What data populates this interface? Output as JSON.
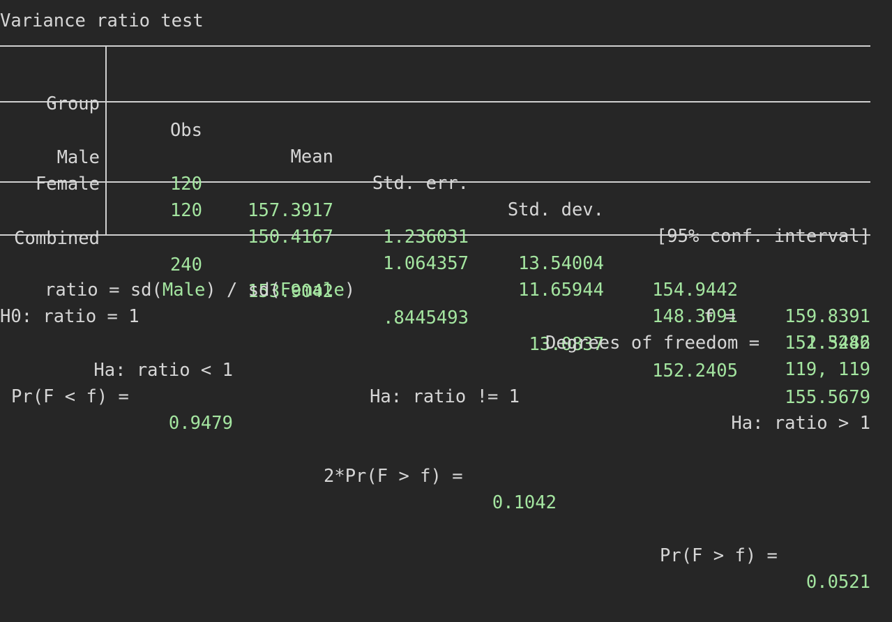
{
  "terminal": {
    "background_color": "#262626",
    "text_color": "#d6d6d6",
    "value_color": "#a4e5a0",
    "rule_color": "#d0d0d0"
  },
  "title": "Variance ratio test",
  "table": {
    "headers": [
      "Group",
      "Obs",
      "Mean",
      "Std. err.",
      "Std. dev.",
      "[95% conf. interval]"
    ],
    "header_group": "Group",
    "header_obs": "Obs",
    "header_mean": "Mean",
    "header_stderr": "Std. err.",
    "header_stddev": "Std. dev.",
    "header_ci": "[95% conf. interval]",
    "rows": [
      {
        "group": "Male",
        "obs": "120",
        "mean": "157.3917",
        "std_err": "1.236031",
        "std_dev": "13.54004",
        "ci_low": "154.9442",
        "ci_high": "159.8391"
      },
      {
        "group": "Female",
        "obs": "120",
        "mean": "150.4167",
        "std_err": "1.064357",
        "std_dev": "11.65944",
        "ci_low": "148.3091",
        "ci_high": "152.5242"
      }
    ],
    "combined": {
      "group": "Combined",
      "obs": "240",
      "mean": "153.9042",
      "std_err": ".8445493",
      "std_dev": "13.0837",
      "ci_low": "152.2405",
      "ci_high": "155.5679"
    }
  },
  "ratio_line": {
    "prefix": "ratio = sd(",
    "group1": "Male",
    "middle": ") / sd(",
    "group2": "Female",
    "suffix": ")",
    "f_label": "f =",
    "f_value": "1.3486"
  },
  "null_line": {
    "h0": "H0: ratio = 1",
    "df_label": "Degrees of freedom =",
    "df_value": "119, 119"
  },
  "alternatives": [
    {
      "ha": "Ha: ratio < 1",
      "prob_label": "Pr(F < f) =",
      "prob_value": "0.9479"
    },
    {
      "ha": "Ha: ratio != 1",
      "prob_label": "2*Pr(F > f) =",
      "prob_value": "0.1042"
    },
    {
      "ha": "Ha: ratio > 1",
      "prob_label": "Pr(F > f) =",
      "prob_value": "0.0521"
    }
  ]
}
